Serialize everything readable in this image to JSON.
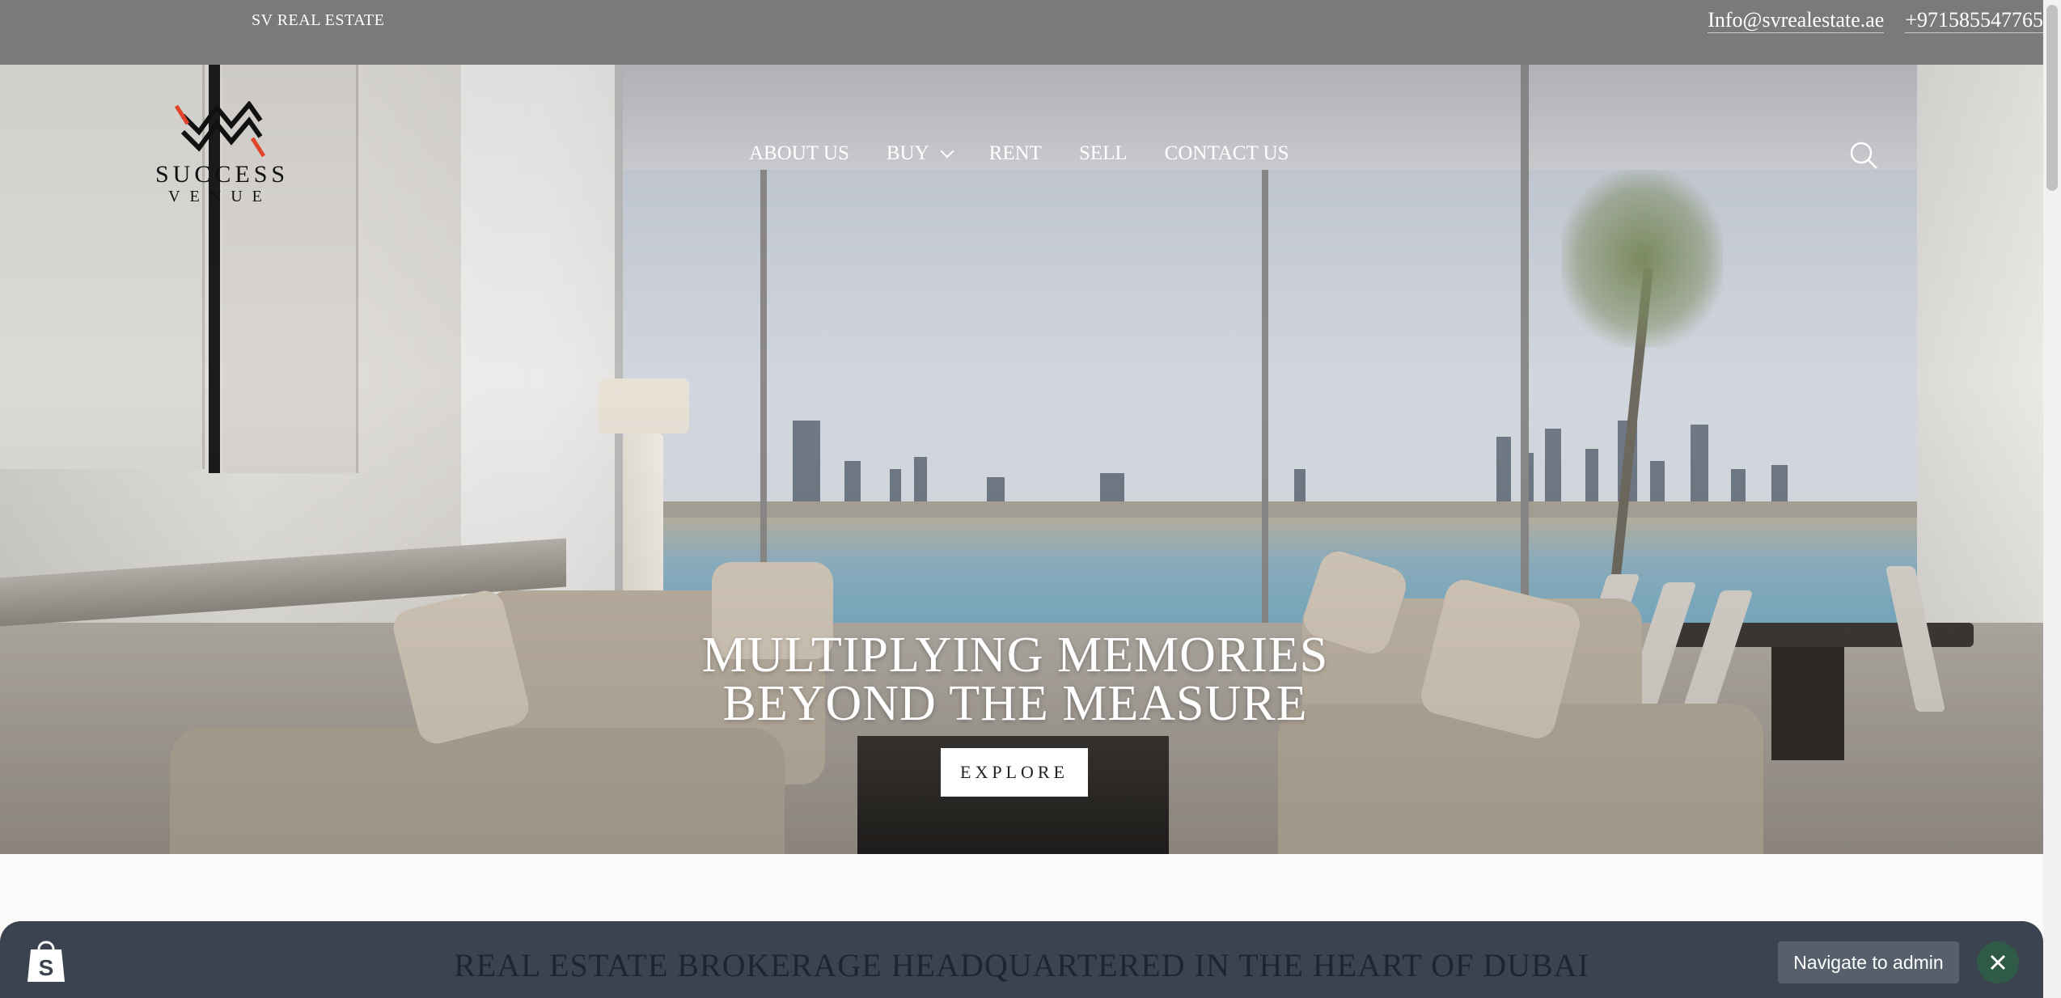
{
  "topbar": {
    "brand": "SV REAL ESTATE",
    "email": "Info@svrealestate.ae",
    "phone": "+971585547765"
  },
  "logo": {
    "line1": "SUCCESS",
    "line2": "VENUE",
    "accent_color": "#e0452a"
  },
  "nav": {
    "items": [
      {
        "label": "ABOUT US"
      },
      {
        "label": "BUY"
      },
      {
        "label": "RENT"
      },
      {
        "label": "SELL"
      },
      {
        "label": "CONTACT US"
      }
    ]
  },
  "hero": {
    "headline_line1": "MULTIPLYING MEMORIES",
    "headline_line2": "BEYOND THE MEASURE",
    "cta_label": "EXPLORE"
  },
  "section": {
    "title": "REAL ESTATE BROKERAGE HEADQUARTERED IN THE HEART OF DUBAI"
  },
  "admin_bar": {
    "navigate_label": "Navigate to admin",
    "icon": "shopify-bag-icon",
    "close_icon": "close-icon"
  }
}
